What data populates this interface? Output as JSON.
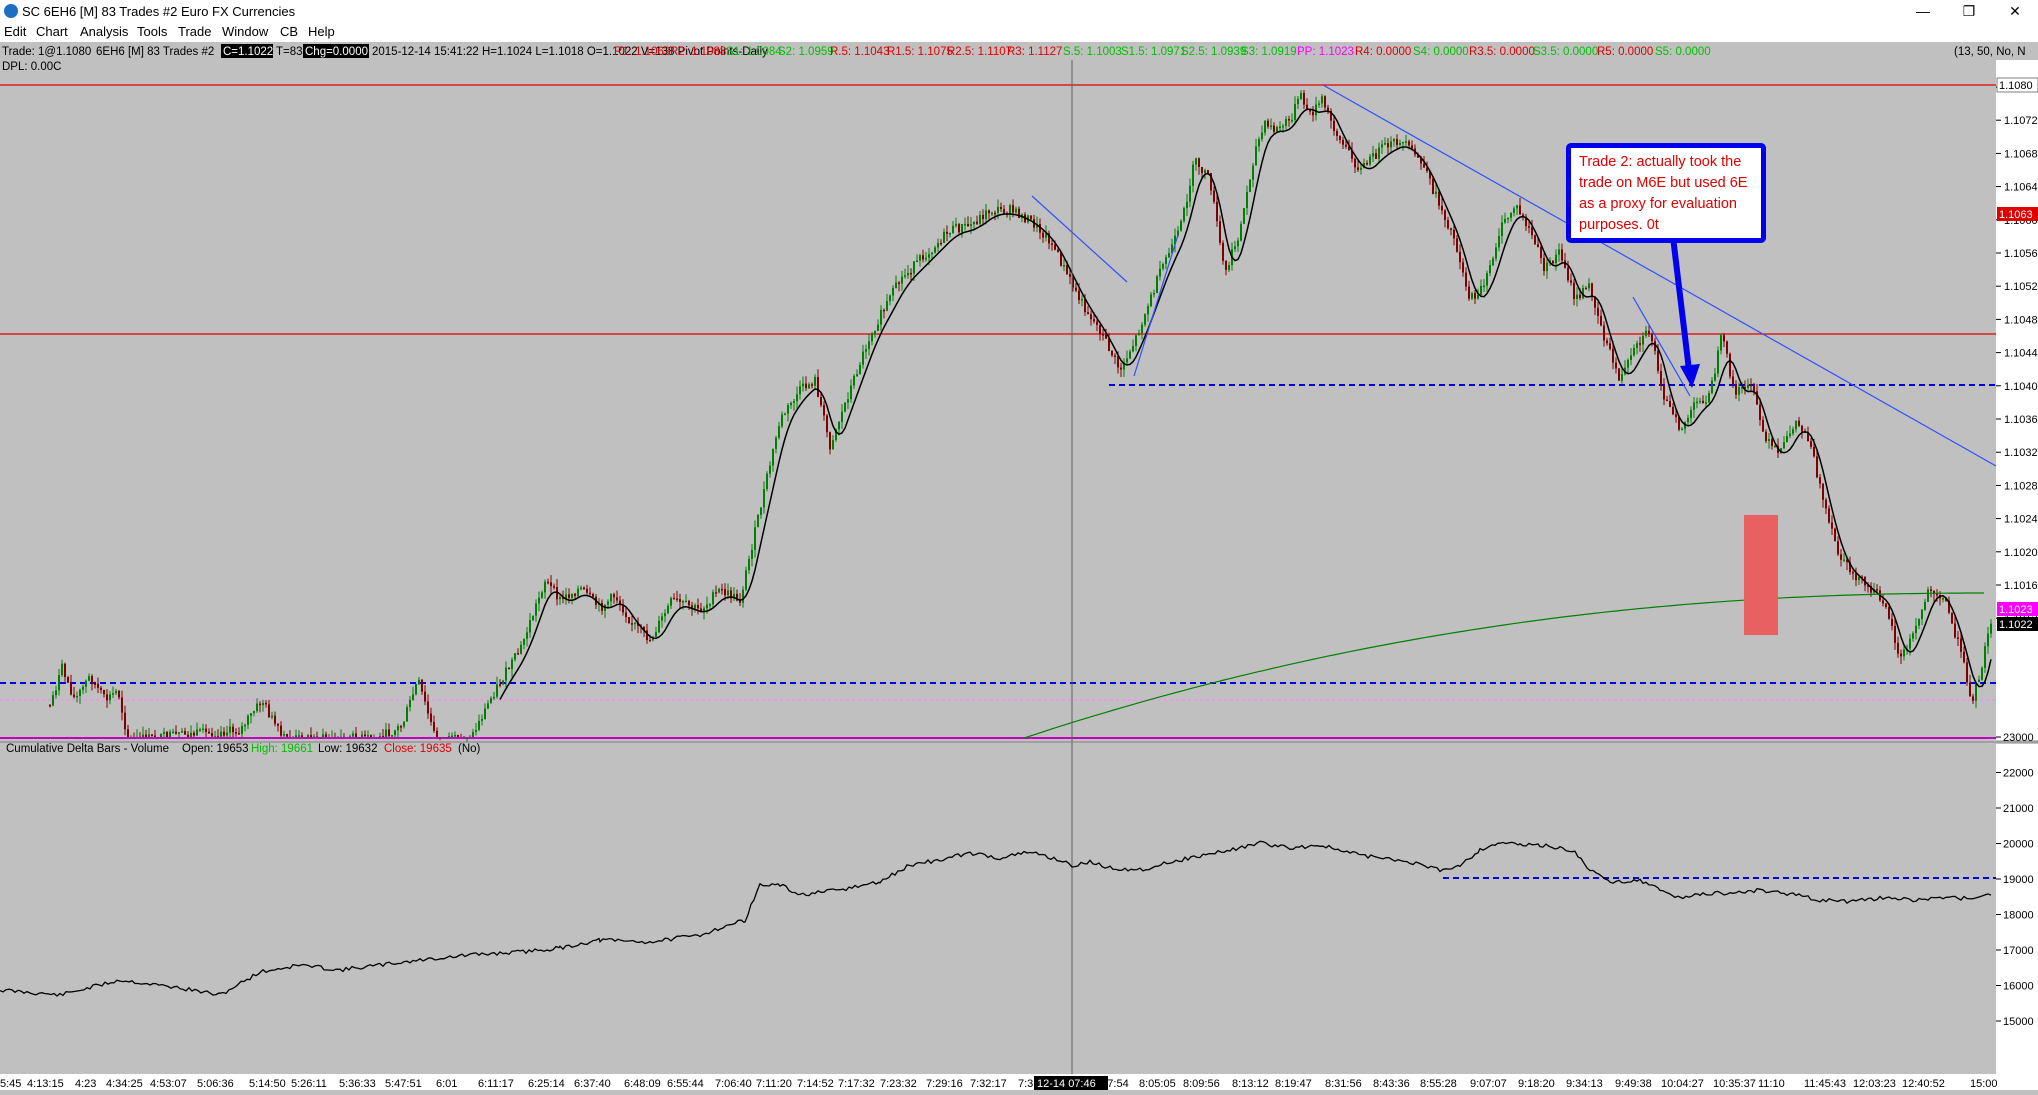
{
  "window": {
    "title": "SC 6EH6 [M]  83 Trades  #2  Euro FX Currencies",
    "minimize_glyph": "—",
    "restore_glyph": "❐",
    "close_glyph": "✕"
  },
  "menu": [
    "Edit",
    "Chart",
    "Analysis",
    "Tools",
    "Trade",
    "Window",
    "CB",
    "Help"
  ],
  "info": {
    "trade": "Trade: 1@1.1080",
    "symbol": "6EH6 [M]  83 Trades  #2",
    "close_label": "C=1.1022",
    "t_label": "T=83",
    "chg_label": "Chg=0.0000",
    "stats": "2015-12-14 15:41:22 H=1.1024 L=1.1018 O=1.1022 V=138 Pivot Points-Daily",
    "pivots": [
      {
        "text": "R1: 1.1063",
        "color": "#e00000"
      },
      {
        "text": "R2: 1.1088",
        "color": "#e00000"
      },
      {
        "text": "S1: 1.0984",
        "color": "#00c000"
      },
      {
        "text": "S2: 1.0959",
        "color": "#00c000"
      },
      {
        "text": "R.5: 1.1043",
        "color": "#e00000"
      },
      {
        "text": "R1.5: 1.1075",
        "color": "#e00000"
      },
      {
        "text": "R2.5: 1.1107",
        "color": "#e00000"
      },
      {
        "text": "R3: 1.1127",
        "color": "#e00000"
      },
      {
        "text": "S.5: 1.1003",
        "color": "#00c000"
      },
      {
        "text": "S1.5: 1.0971",
        "color": "#00c000"
      },
      {
        "text": "S2.5: 1.0939",
        "color": "#00c000"
      },
      {
        "text": "S3: 1.0919",
        "color": "#00c000"
      },
      {
        "text": "PP: 1.1023",
        "color": "#ff00ff"
      },
      {
        "text": "R4: 0.0000",
        "color": "#e00000"
      },
      {
        "text": "S4: 0.0000",
        "color": "#00c000"
      },
      {
        "text": "R3.5: 0.0000",
        "color": "#e00000"
      },
      {
        "text": "S3.5: 0.0000",
        "color": "#00c000"
      },
      {
        "text": "R5: 0.0000",
        "color": "#e00000"
      },
      {
        "text": "S5: 0.0000",
        "color": "#00c000"
      }
    ],
    "tail": "(13, 50, No, N",
    "dpl": "DPL: 0.00C"
  },
  "annotation": "Trade 2: actually took the trade on M6E but used 6E as a proxy for evaluation purposes.  0t",
  "lower_label": {
    "name": "Cumulative Delta Bars - Volume",
    "open": "Open: 19653",
    "high": "High: 19661",
    "low": "Low: 19632",
    "close": "Close: 19635",
    "tail": "(No)"
  },
  "price_axis": {
    "ticks": [
      "1.1076",
      "1.1072",
      "1.1068",
      "1.1064",
      "1.1060",
      "1.1056",
      "1.1052",
      "1.1048",
      "1.1044",
      "1.1040",
      "1.1036",
      "1.1032",
      "1.1028",
      "1.1024",
      "1.1020",
      "1.1016",
      "1.1012"
    ],
    "top_badge": "1.1080",
    "r1_badge": "1.1063",
    "pp_badge": "1.1023",
    "last_badge": "1.1022"
  },
  "delta_axis": {
    "ticks": [
      "23000",
      "22000",
      "21000",
      "20000",
      "19000",
      "18000",
      "17000",
      "16000",
      "15000"
    ]
  },
  "time_axis": {
    "ticks": [
      "5:45",
      "4:13:15",
      "4:23",
      "4:34:25",
      "4:53:07",
      "5:06:36",
      "5:14:50",
      "5:26:11",
      "5:36:33",
      "5:47:51",
      "6:01",
      "6:11:17",
      "6:25:14",
      "6:37:40",
      "6:48:09",
      "6:55:44",
      "7:06:40",
      "7:11:20",
      "7:14:52",
      "7:17:32",
      "7:23:32",
      "7:29:16",
      "7:32:17",
      "7:3",
      "7:57:54",
      "8:05:05",
      "8:09:56",
      "8:13:12",
      "8:19:47",
      "8:31:56",
      "8:43:36",
      "8:55:28",
      "9:07:07",
      "9:18:20",
      "9:34:13",
      "9:49:38",
      "10:04:27",
      "10:35:37",
      "11:10",
      "11:45:43",
      "12:03:23",
      "12:40:52",
      "15:00"
    ],
    "cursor_label": "12-14 07:46"
  },
  "colors": {
    "background": "#c0c0c0",
    "up_bar": "#008000",
    "down_bar": "#800000",
    "pivot_line": "#e00000",
    "blue_dash": "#0000e0",
    "ma_line": "#000000",
    "long_ma": "#008000",
    "trendline": "#3050ff",
    "box": "#e86060"
  }
}
